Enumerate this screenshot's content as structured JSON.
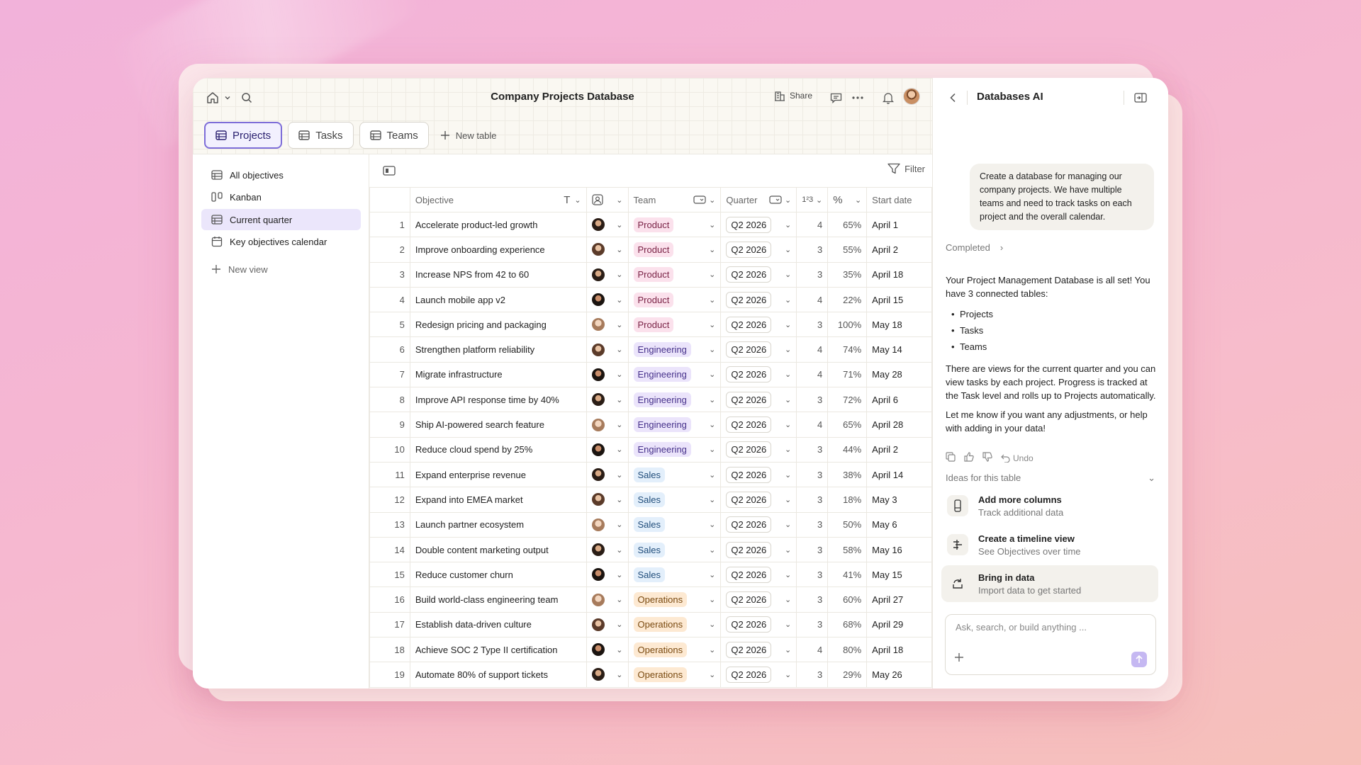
{
  "app": {
    "title": "Company Projects Database"
  },
  "topbar": {
    "share_label": "Share"
  },
  "tabs": [
    {
      "label": "Projects",
      "active": true
    },
    {
      "label": "Tasks",
      "active": false
    },
    {
      "label": "Teams",
      "active": false
    }
  ],
  "new_table_label": "New table",
  "sidebar": {
    "items": [
      {
        "label": "All objectives",
        "icon": "table-icon"
      },
      {
        "label": "Kanban",
        "icon": "kanban-icon"
      },
      {
        "label": "Current quarter",
        "icon": "table-icon",
        "active": true
      },
      {
        "label": "Key objectives calendar",
        "icon": "calendar-icon"
      }
    ],
    "new_view_label": "New view"
  },
  "toolbar": {
    "filter_label": "Filter"
  },
  "table": {
    "columns": {
      "objective": "Objective",
      "team": "Team",
      "quarter": "Quarter",
      "start_date": "Start date",
      "count_icon": "1²3",
      "percent_icon": "%"
    },
    "rows": [
      {
        "n": "1",
        "objective": "Accelerate product-led growth",
        "team": "Product",
        "quarter": "Q2 2026",
        "count": "4",
        "pct": "65%",
        "start": "April 1",
        "av": "av1"
      },
      {
        "n": "2",
        "objective": "Improve onboarding experience",
        "team": "Product",
        "quarter": "Q2 2026",
        "count": "3",
        "pct": "55%",
        "start": "April 2",
        "av": "av2"
      },
      {
        "n": "3",
        "objective": "Increase NPS from 42 to 60",
        "team": "Product",
        "quarter": "Q2 2026",
        "count": "3",
        "pct": "35%",
        "start": "April 18",
        "av": "av1"
      },
      {
        "n": "4",
        "objective": "Launch mobile app v2",
        "team": "Product",
        "quarter": "Q2 2026",
        "count": "4",
        "pct": "22%",
        "start": "April 15",
        "av": "av4"
      },
      {
        "n": "5",
        "objective": "Redesign pricing and packaging",
        "team": "Product",
        "quarter": "Q2 2026",
        "count": "3",
        "pct": "100%",
        "start": "May 18",
        "av": "av3"
      },
      {
        "n": "6",
        "objective": "Strengthen platform reliability",
        "team": "Engineering",
        "quarter": "Q2 2026",
        "count": "4",
        "pct": "74%",
        "start": "May 14",
        "av": "av2"
      },
      {
        "n": "7",
        "objective": "Migrate infrastructure",
        "team": "Engineering",
        "quarter": "Q2 2026",
        "count": "4",
        "pct": "71%",
        "start": "May 28",
        "av": "av4"
      },
      {
        "n": "8",
        "objective": "Improve API response time by 40%",
        "team": "Engineering",
        "quarter": "Q2 2026",
        "count": "3",
        "pct": "72%",
        "start": "April 6",
        "av": "av1"
      },
      {
        "n": "9",
        "objective": "Ship AI-powered search feature",
        "team": "Engineering",
        "quarter": "Q2 2026",
        "count": "4",
        "pct": "65%",
        "start": "April 28",
        "av": "av3"
      },
      {
        "n": "10",
        "objective": "Reduce cloud spend by 25%",
        "team": "Engineering",
        "quarter": "Q2 2026",
        "count": "3",
        "pct": "44%",
        "start": "April 2",
        "av": "av4"
      },
      {
        "n": "11",
        "objective": "Expand enterprise revenue",
        "team": "Sales",
        "quarter": "Q2 2026",
        "count": "3",
        "pct": "38%",
        "start": "April 14",
        "av": "av1"
      },
      {
        "n": "12",
        "objective": "Expand into EMEA market",
        "team": "Sales",
        "quarter": "Q2 2026",
        "count": "3",
        "pct": "18%",
        "start": "May 3",
        "av": "av2"
      },
      {
        "n": "13",
        "objective": "Launch partner ecosystem",
        "team": "Sales",
        "quarter": "Q2 2026",
        "count": "3",
        "pct": "50%",
        "start": "May 6",
        "av": "av3"
      },
      {
        "n": "14",
        "objective": "Double content marketing output",
        "team": "Sales",
        "quarter": "Q2 2026",
        "count": "3",
        "pct": "58%",
        "start": "May 16",
        "av": "av1"
      },
      {
        "n": "15",
        "objective": "Reduce customer churn",
        "team": "Sales",
        "quarter": "Q2 2026",
        "count": "3",
        "pct": "41%",
        "start": "May 15",
        "av": "av4"
      },
      {
        "n": "16",
        "objective": "Build world-class engineering team",
        "team": "Operations",
        "quarter": "Q2 2026",
        "count": "3",
        "pct": "60%",
        "start": "April 27",
        "av": "av3"
      },
      {
        "n": "17",
        "objective": "Establish data-driven culture",
        "team": "Operations",
        "quarter": "Q2 2026",
        "count": "3",
        "pct": "68%",
        "start": "April 29",
        "av": "av2"
      },
      {
        "n": "18",
        "objective": "Achieve SOC 2 Type II certification",
        "team": "Operations",
        "quarter": "Q2 2026",
        "count": "4",
        "pct": "80%",
        "start": "April 18",
        "av": "av4"
      },
      {
        "n": "19",
        "objective": "Automate 80% of support tickets",
        "team": "Operations",
        "quarter": "Q2 2026",
        "count": "3",
        "pct": "29%",
        "start": "May 26",
        "av": "av1"
      }
    ]
  },
  "ai": {
    "title": "Databases AI",
    "user_message": "Create a database for managing our company projects. We have multiple teams and need to track tasks on each project and the overall calendar.",
    "completed_label": "Completed",
    "answer_intro": "Your Project Management Database is all set! You have 3 connected tables:",
    "answer_list": [
      "Projects",
      "Tasks",
      "Teams"
    ],
    "answer_p2": "There are views for the current quarter and you can view tasks by each project. Progress is tracked at the Task level and rolls up to Projects automatically.",
    "answer_p3": "Let me know if you want any adjustments, or help with adding in your data!",
    "undo_label": "Undo",
    "ideas_label": "Ideas for this table",
    "ideas": [
      {
        "title": "Add more columns",
        "sub": "Track additional data"
      },
      {
        "title": "Create a timeline view",
        "sub": "See Objectives over time"
      },
      {
        "title": "Bring in data",
        "sub": "Import data to get started"
      }
    ],
    "composer_placeholder": "Ask, search, or build anything ..."
  },
  "colors": {
    "accent": "#7d6dd8",
    "product": "#fbe1ec",
    "engineering": "#ebe4fb",
    "sales": "#e3effb",
    "operations": "#fde9d2"
  }
}
